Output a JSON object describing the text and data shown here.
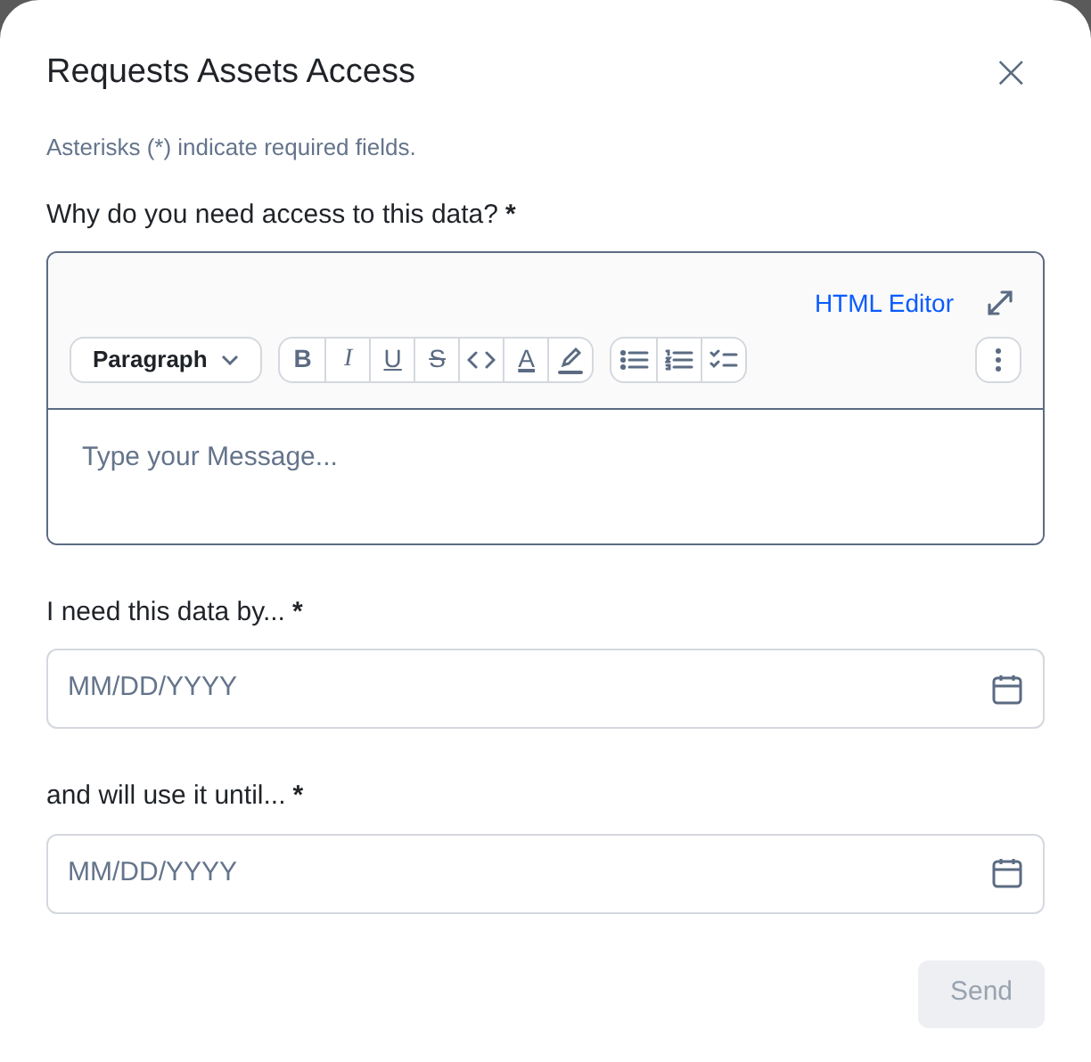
{
  "dialog": {
    "title": "Requests Assets Access",
    "close": "×",
    "note": "Asterisks (*) indicate required fields."
  },
  "message": {
    "label": "Why do you need access to this data?",
    "required_mark": "*",
    "html_editor": "HTML Editor",
    "block_style": "Paragraph",
    "format_buttons": [
      {
        "kind": "bold",
        "glyph": "B"
      },
      {
        "kind": "italic",
        "glyph": "I"
      },
      {
        "kind": "underline",
        "glyph": "U"
      },
      {
        "kind": "strike",
        "glyph": "S"
      },
      {
        "kind": "code"
      },
      {
        "kind": "color",
        "glyph": "A"
      },
      {
        "kind": "highlight"
      }
    ],
    "list_buttons": [
      {
        "kind": "bullets"
      },
      {
        "kind": "numbers"
      },
      {
        "kind": "checklist"
      }
    ],
    "placeholder": "Type your Message..."
  },
  "dates": [
    {
      "label": "I need this data by...",
      "required_mark": "*",
      "placeholder": "MM/DD/YYYY"
    },
    {
      "label": "and will use it until...",
      "required_mark": "*",
      "placeholder": "MM/DD/YYYY"
    }
  ],
  "send": {
    "label": "Send",
    "disabled": true
  }
}
